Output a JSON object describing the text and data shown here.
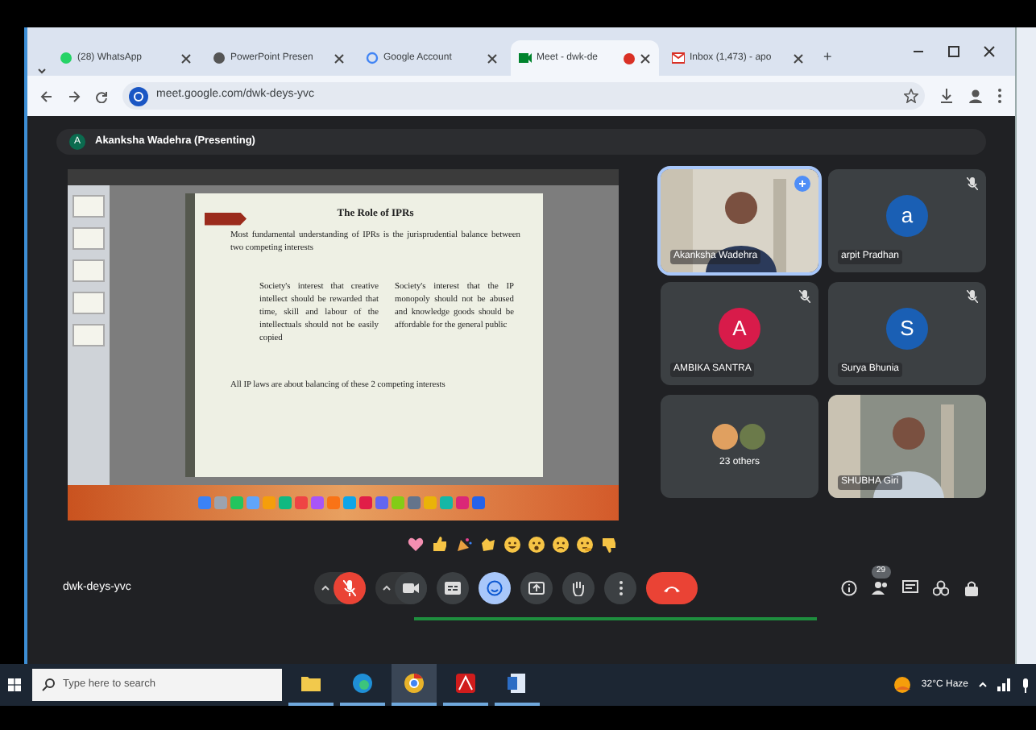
{
  "browser": {
    "tabs": [
      {
        "title": "(28) WhatsApp",
        "selected": false,
        "recording": false
      },
      {
        "title": "PowerPoint Presen",
        "selected": false,
        "recording": false
      },
      {
        "title": "Google Account",
        "selected": false,
        "recording": false
      },
      {
        "title": "Meet - dwk-de",
        "selected": true,
        "recording": true
      },
      {
        "title": "Inbox (1,473) - apo",
        "selected": false,
        "recording": false
      }
    ],
    "new_tab": "+",
    "url": "meet.google.com/dwk-deys-yvc"
  },
  "presenting_banner": {
    "avatar_letter": "A",
    "text": "Akanksha Wadehra (Presenting)"
  },
  "shared_slide": {
    "title": "The Role of IPRs",
    "bullet": "Most fundamental understanding of IPRs is the jurisprudential balance between two competing interests",
    "columns": [
      "Society's interest that creative intellect should be rewarded that time, skill and labour of the intellectuals should not be easily copied",
      "Society's interest that the IP monopoly should not be abused and knowledge goods should be affordable for the general public"
    ],
    "footer": "All IP laws are about balancing of these 2 competing interests"
  },
  "tiles": [
    {
      "kind": "video",
      "name": "Akanksha Wadehra",
      "highlighted": true,
      "muted": false
    },
    {
      "kind": "avatar",
      "name": "arpit Pradhan",
      "letter": "a",
      "color": "#1a5fb4",
      "highlighted": false,
      "muted": true
    },
    {
      "kind": "avatar",
      "name": "AMBIKA SANTRA",
      "letter": "A",
      "color": "#d81b4a",
      "highlighted": false,
      "muted": true
    },
    {
      "kind": "avatar",
      "name": "Surya Bhunia",
      "letter": "S",
      "color": "#1a5fb4",
      "highlighted": false,
      "muted": true
    },
    {
      "kind": "others",
      "name": "23 others",
      "highlighted": false,
      "muted": false
    },
    {
      "kind": "video",
      "name": "SHUBHA Giri",
      "highlighted": false,
      "muted": false
    }
  ],
  "reactions": [
    {
      "kind": "heart"
    },
    {
      "kind": "thumbs_up"
    },
    {
      "kind": "party"
    },
    {
      "kind": "clap"
    },
    {
      "kind": "laugh"
    },
    {
      "kind": "surprised"
    },
    {
      "kind": "sad"
    },
    {
      "kind": "thinking"
    },
    {
      "kind": "thumbs_down"
    }
  ],
  "meeting_code": "dwk-deys-yvc",
  "controls": [
    {
      "kind": "mic",
      "muted": true
    },
    {
      "kind": "camera",
      "muted": false
    },
    {
      "kind": "captions"
    },
    {
      "kind": "emoji",
      "active": true
    },
    {
      "kind": "present"
    },
    {
      "kind": "hand"
    },
    {
      "kind": "more"
    },
    {
      "kind": "end"
    }
  ],
  "side_actions": [
    {
      "kind": "info"
    },
    {
      "kind": "people",
      "badge": "29"
    },
    {
      "kind": "chat"
    },
    {
      "kind": "activities"
    },
    {
      "kind": "host"
    }
  ],
  "taskbar": {
    "search_placeholder": "Type here to search",
    "apps": [
      {
        "kind": "files",
        "selected": false
      },
      {
        "kind": "edge",
        "selected": false
      },
      {
        "kind": "chrome",
        "selected": true
      },
      {
        "kind": "acrobat",
        "selected": false
      },
      {
        "kind": "notes",
        "selected": false
      }
    ],
    "weather": "32°C Haze"
  }
}
